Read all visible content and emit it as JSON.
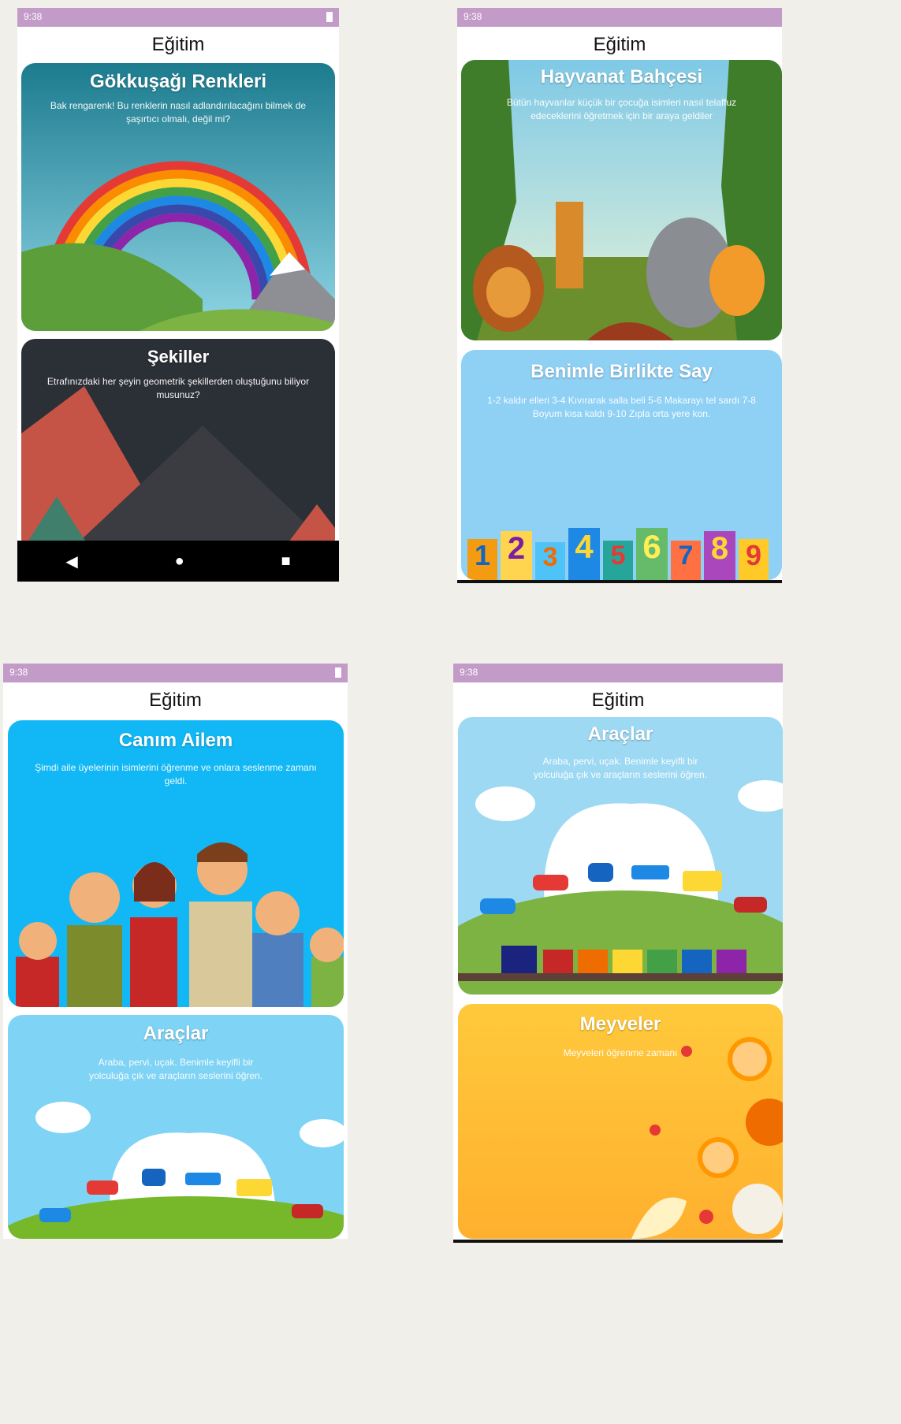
{
  "colors": {
    "status_bar": "#c29bc8",
    "background": "#f1efe9",
    "sky_blue": "#7fd3f5",
    "family_blue": "#11b8f5",
    "fruit_orange": "#ffb02e",
    "shapes_dark": "#2b2f36"
  },
  "screens": [
    {
      "status_time": "9:38",
      "app_title": "Eğitim",
      "cards": [
        {
          "title": "Gökkuşağı Renkleri",
          "desc": "Bak rengarenk! Bu renklerin nasıl adlandırılacağını bilmek de şaşırtıcı olmalı, değil mi?"
        },
        {
          "title": "Şekiller",
          "desc": "Etrafınızdaki her şeyin geometrik şekillerden oluştuğunu biliyor musunuz?"
        }
      ],
      "nav": {
        "back_icon": "◀",
        "home_icon": "●",
        "recents_icon": "■"
      }
    },
    {
      "status_time": "9:38",
      "app_title": "Eğitim",
      "cards": [
        {
          "title": "Hayvanat Bahçesi",
          "desc": "Bütün hayvanlar küçük bir çocuğa isimleri nasıl telaffuz edeceklerini öğretmek için bir araya geldiler"
        },
        {
          "title": "Benimle Birlikte Say",
          "desc": "1-2 kaldır elleri 3-4 Kıvırarak salla beli 5-6 Makarayı tel sardı 7-8 Boyum kısa kaldı 9-10 Zıpla orta yere kon.",
          "digits": [
            "1",
            "2",
            "3",
            "4",
            "5",
            "6",
            "7",
            "8",
            "9"
          ]
        }
      ]
    },
    {
      "status_time": "9:38",
      "app_title": "Eğitim",
      "cards": [
        {
          "title": "Canım Ailem",
          "desc": "Şimdi aile üyelerinin isimlerini öğrenme ve onlara seslenme zamanı geldi."
        },
        {
          "title": "Araçlar",
          "desc": "Araba, pervi, uçak. Benimle keyifli bir yolculuğa çık ve araçların seslerini öğren."
        }
      ]
    },
    {
      "status_time": "9:38",
      "app_title": "Eğitim",
      "cards": [
        {
          "title": "Araçlar",
          "desc": "Araba, pervi, uçak. Benimle keyifli bir yolculuğa çık ve araçların seslerini öğren."
        },
        {
          "title": "Meyveler",
          "desc": "Meyveleri öğrenme zamanı"
        }
      ]
    }
  ]
}
